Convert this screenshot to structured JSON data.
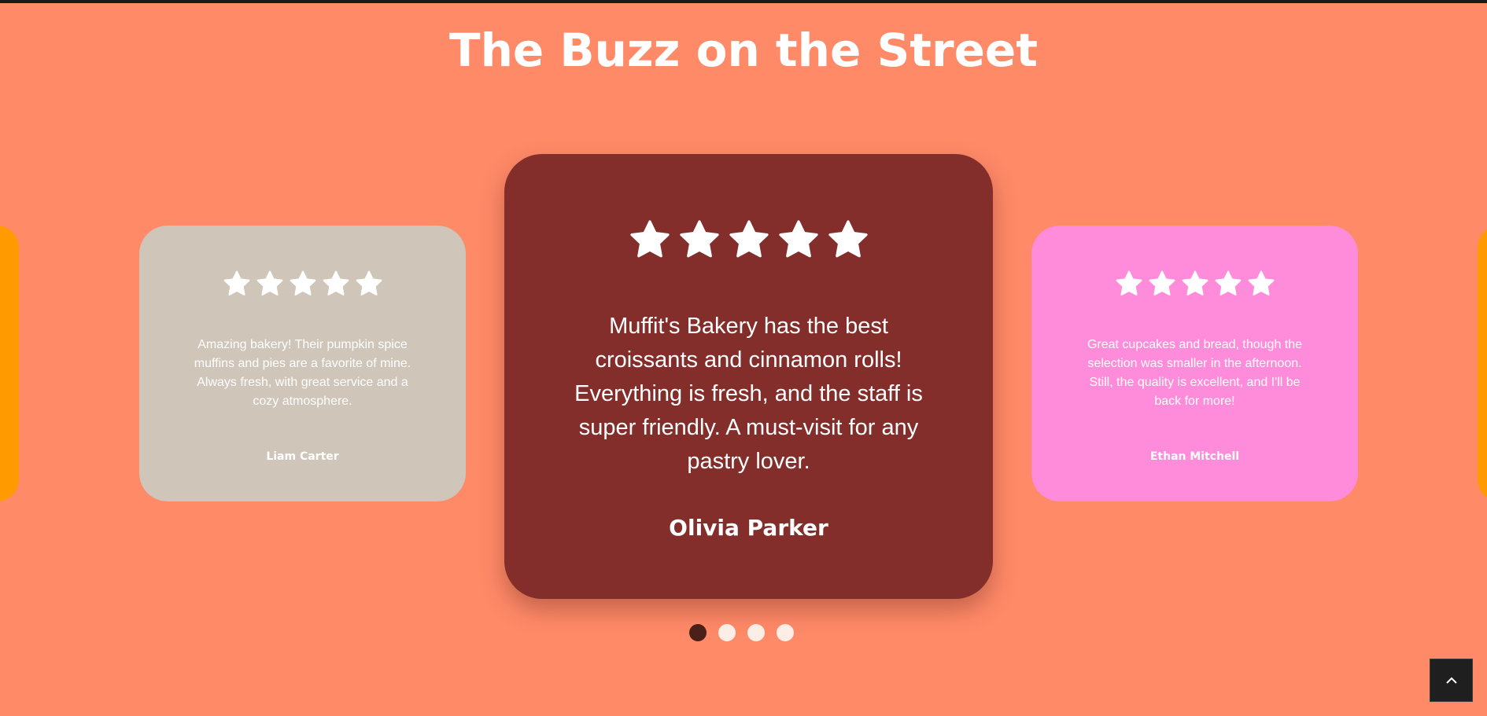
{
  "section": {
    "title": "The Buzz on the Street"
  },
  "carousel": {
    "testimonials": [
      {
        "position": "left",
        "rating": 5,
        "quote": "Amazing bakery! Their pumpkin spice muffins and pies are a favorite of mine. Always fresh, with great service and a cozy atmosphere.",
        "author": "Liam Carter",
        "color": "#CFC5B9"
      },
      {
        "position": "center",
        "rating": 5,
        "quote": "Muffit's Bakery has the best croissants and cinnamon rolls! Everything is fresh, and the staff is super friendly. A must-visit for any pastry lover.",
        "author": "Olivia Parker",
        "color": "#842E2B"
      },
      {
        "position": "right",
        "rating": 5,
        "quote": "Great cupcakes and bread, though the selection was smaller in the afternoon. Still, the quality is excellent, and I'll be back for more!",
        "author": "Ethan Mitchell",
        "color": "#FF8CDA"
      }
    ],
    "partial_card_color": "#FF9A00",
    "dots": {
      "count": 4,
      "active_index": 0
    }
  },
  "colors": {
    "background": "#FF8A68",
    "dot_active": "#4A2018",
    "dot_inactive": "#FDEDE7"
  },
  "scroll_top_button": {
    "icon": "chevron-up-icon"
  }
}
